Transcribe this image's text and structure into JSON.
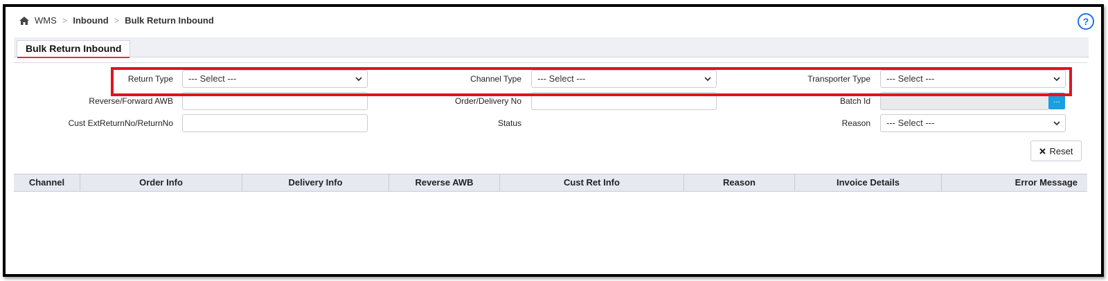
{
  "breadcrumb": {
    "root": "WMS",
    "sep": ">",
    "level1": "Inbound",
    "current": "Bulk Return Inbound"
  },
  "help_icon": "question-circle-icon",
  "tabs": [
    {
      "label": "Bulk Return Inbound",
      "active": true
    }
  ],
  "form": {
    "return_type": {
      "label": "Return Type",
      "value": "--- Select ---"
    },
    "channel_type": {
      "label": "Channel Type",
      "value": "--- Select ---"
    },
    "transporter_type": {
      "label": "Transporter Type",
      "value": "--- Select ---"
    },
    "awb": {
      "label": "Reverse/Forward AWB",
      "value": ""
    },
    "order_delivery": {
      "label": "Order/Delivery No",
      "value": ""
    },
    "batch_id": {
      "label": "Batch Id",
      "value": "",
      "button": "..."
    },
    "cust_ext": {
      "label": "Cust ExtReturnNo/ReturnNo",
      "value": ""
    },
    "status": {
      "label": "Status"
    },
    "reason": {
      "label": "Reason",
      "value": "--- Select ---"
    }
  },
  "reset_button": {
    "label": "Reset",
    "icon": "close-x-icon"
  },
  "table": {
    "columns": [
      "Channel",
      "Order Info",
      "Delivery Info",
      "Reverse AWB",
      "Cust Ret Info",
      "Reason",
      "Invoice Details",
      "Error Message"
    ]
  },
  "colors": {
    "accent_blue": "#1a73e8",
    "highlight_red": "#e0141e",
    "header_bg": "#e7e9f2"
  }
}
